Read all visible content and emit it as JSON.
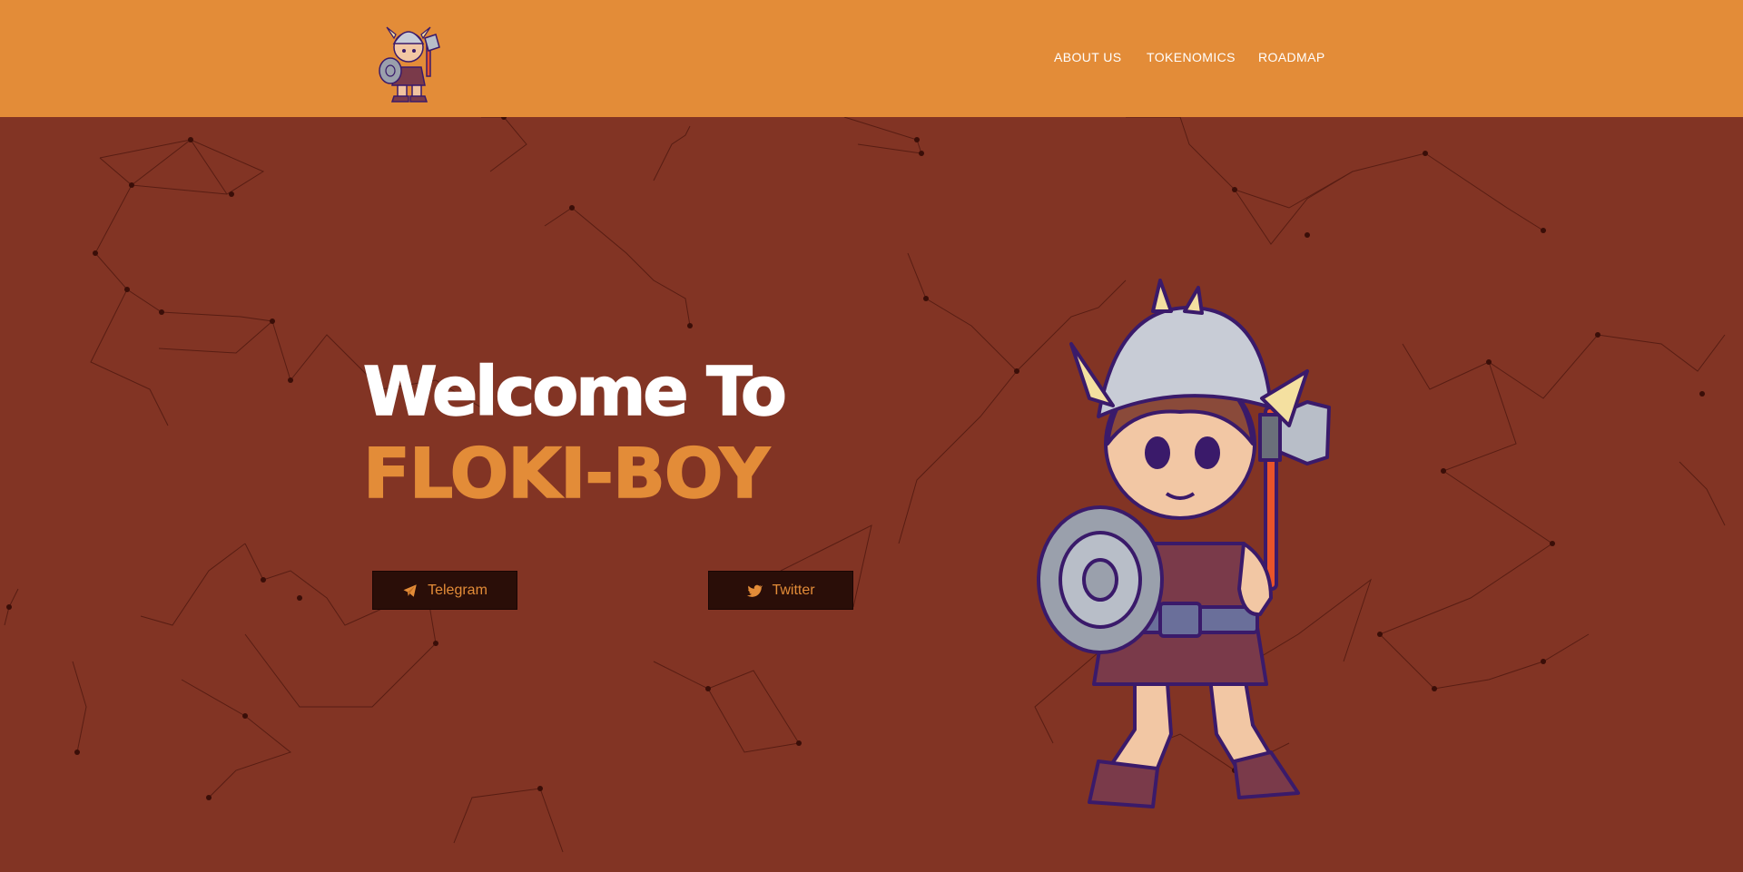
{
  "header": {
    "logo_icon": "viking-boy-logo-icon",
    "nav": [
      "ABOUT US",
      "TOKENOMICS",
      "ROADMAP"
    ]
  },
  "hero": {
    "title_line1": "Welcome To",
    "title_line2": "FLOKI-BOY",
    "buttons": [
      {
        "label": "Telegram",
        "icon": "telegram-icon"
      },
      {
        "label": "Twitter",
        "icon": "twitter-icon"
      }
    ],
    "mascot_icon": "viking-boy-mascot-icon"
  },
  "colors": {
    "header_bg": "#e38c38",
    "page_bg": "#823424",
    "accent": "#e38c38",
    "button_bg": "#2a0e08",
    "title_white": "#ffffff"
  }
}
